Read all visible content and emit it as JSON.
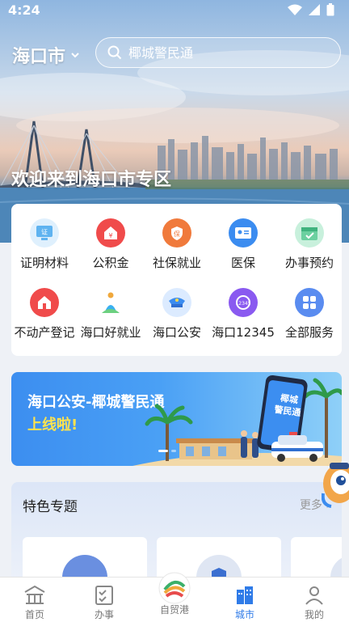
{
  "status_bar": {
    "time": "4:24"
  },
  "header": {
    "city": "海口市",
    "search_placeholder": "椰城警民通"
  },
  "hero": {
    "welcome": "欢迎来到海口市专区"
  },
  "services": [
    {
      "label": "证明材料",
      "icon": "certificate-icon",
      "color": "#5fb3f0"
    },
    {
      "label": "公积金",
      "icon": "housing-fund-icon",
      "color": "#f04b4b"
    },
    {
      "label": "社保就业",
      "icon": "social-security-icon",
      "color": "#f07a3c"
    },
    {
      "label": "医保",
      "icon": "medical-insurance-icon",
      "color": "#3b8cf0"
    },
    {
      "label": "办事预约",
      "icon": "appointment-icon",
      "color": "#6cd0a0"
    },
    {
      "label": "不动产登记",
      "icon": "real-estate-icon",
      "color": "#f04b4b"
    },
    {
      "label": "海口好就业",
      "icon": "employment-icon",
      "color": "#3ab0f0"
    },
    {
      "label": "海口公安",
      "icon": "police-icon",
      "color": "#3b8cf0"
    },
    {
      "label": "海口12345",
      "icon": "hotline-icon",
      "color": "#8a5af0"
    },
    {
      "label": "全部服务",
      "icon": "all-services-icon",
      "color": "#5a8cf0"
    }
  ],
  "banner": {
    "title": "海口公安-椰城警民通",
    "subtitle": "上线啦!",
    "phone_text_line1": "椰城",
    "phone_text_line2": "警民通"
  },
  "featured": {
    "title": "特色专题",
    "more": "更多"
  },
  "tabbar": [
    {
      "label": "首页",
      "icon": "home-icon",
      "active": false
    },
    {
      "label": "办事",
      "icon": "tasks-icon",
      "active": false
    },
    {
      "label": "自贸港",
      "icon": "free-trade-port-icon",
      "active": false
    },
    {
      "label": "城市",
      "icon": "city-icon",
      "active": true
    },
    {
      "label": "我的",
      "icon": "profile-icon",
      "active": false
    }
  ],
  "colors": {
    "accent": "#2f7be8",
    "banner_yellow": "#ffe34d"
  }
}
